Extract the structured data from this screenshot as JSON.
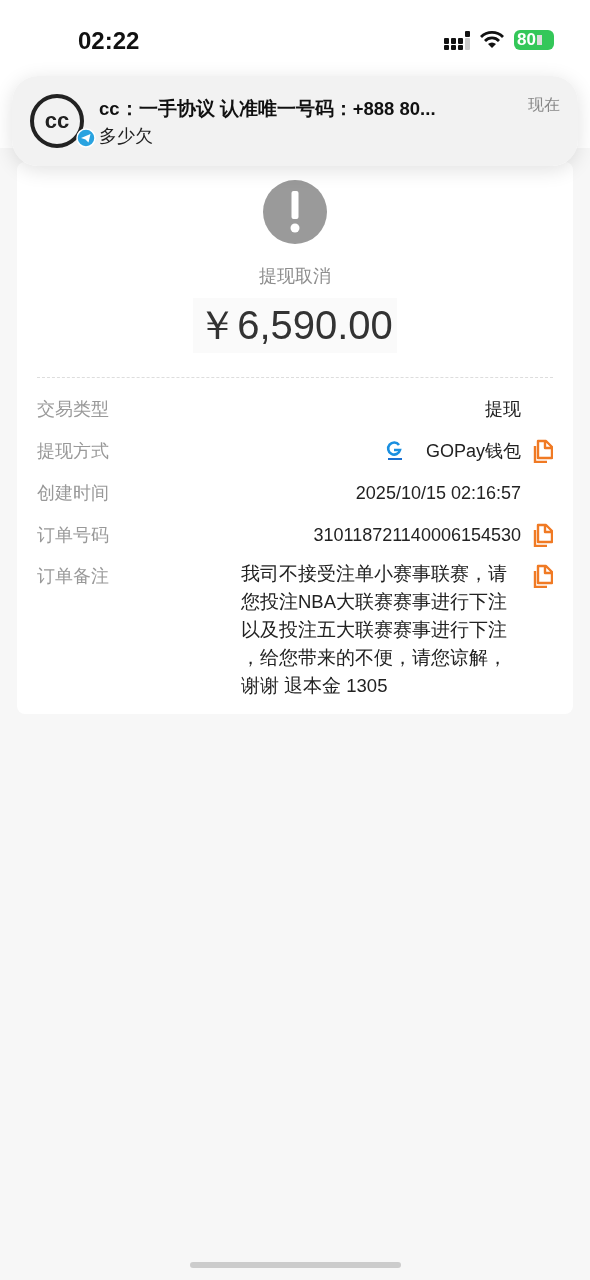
{
  "status_bar": {
    "time": "02:22",
    "battery": "80"
  },
  "notification": {
    "avatar_text": "cc",
    "title": "cc：一手协议 认准唯一号码：+888 80...",
    "body": "多少欠",
    "time": "现在"
  },
  "result": {
    "status": "提现取消",
    "amount": "￥6,590.00"
  },
  "details": [
    {
      "label": "交易类型",
      "value": "提现",
      "copyable": false,
      "kind": "plain"
    },
    {
      "label": "提现方式",
      "value": "GOPay钱包",
      "copyable": true,
      "kind": "method"
    },
    {
      "label": "创建时间",
      "value": "2025/10/15 02:16:57",
      "copyable": false,
      "kind": "plain"
    },
    {
      "label": "订单号码",
      "value": "310118721140006154530",
      "copyable": true,
      "kind": "plain"
    },
    {
      "label": "订单备注",
      "value": "我司不接受注单小赛事联赛，请您投注NBA大联赛赛事进行下注以及投注五大联赛赛事进行下注，给您带来的不便，请您谅解，谢谢 退本金  1305",
      "copyable": true,
      "kind": "note"
    }
  ]
}
